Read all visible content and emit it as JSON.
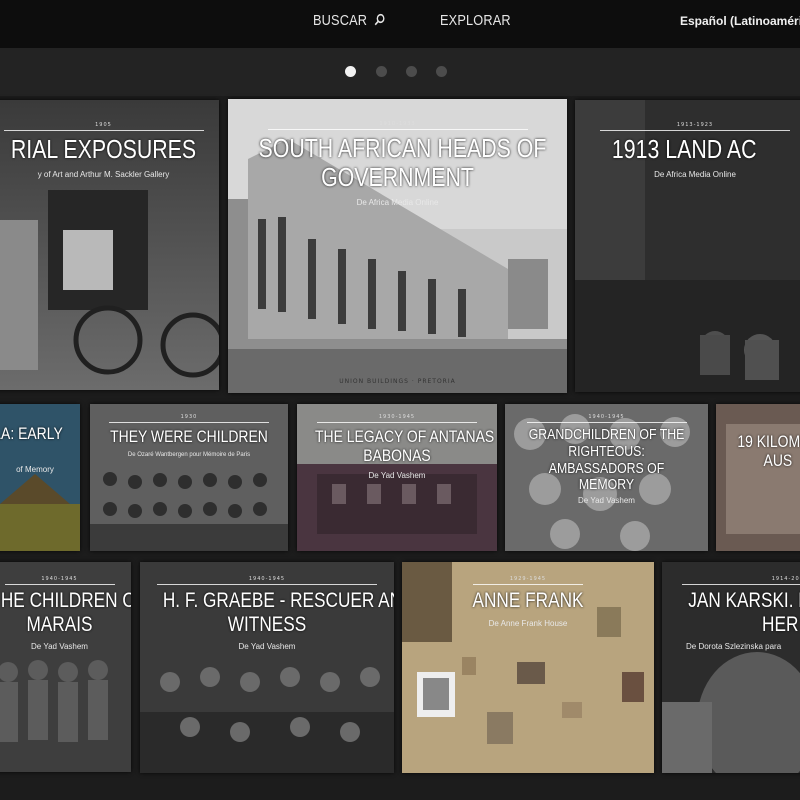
{
  "nav": {
    "search_label": "BUSCAR",
    "explore_label": "EXPLORAR",
    "language_label": "Español (Latinoamérica)"
  },
  "carousel": {
    "page_count": 4,
    "active_page": 1
  },
  "row1": [
    {
      "date": "1905",
      "title_lines": [
        "RIAL EXPOSURES",
        ""
      ],
      "source": "y of Art and Arthur M. Sackler Gallery"
    },
    {
      "date": "1910-1933",
      "title_lines": [
        "SOUTH AFRICAN HEADS OF",
        "GOVERNMENT"
      ],
      "source": "De Africa Media Online",
      "caption": "UNION BUILDINGS · PRETORIA"
    },
    {
      "date": "1913-1923",
      "title_lines": [
        "1913 LAND AC",
        ""
      ],
      "source": "De Africa Media Online"
    }
  ],
  "row2": [
    {
      "date": "",
      "title_lines": [
        "LA: EARLY",
        ""
      ],
      "source": "of Memory"
    },
    {
      "date": "1930",
      "title_lines": [
        "THEY WERE CHILDREN",
        ""
      ],
      "source": "De Ozaré Wantbergen pour Mémoire de Paris"
    },
    {
      "date": "1930-1945",
      "title_lines": [
        "THE LEGACY OF ANTANAS",
        "BABONAS"
      ],
      "source": "De Yad Vashem"
    },
    {
      "date": "1940-1945",
      "title_lines": [
        "GRANDCHILDREN OF THE",
        "RIGHTEOUS:",
        "AMBASSADORS OF",
        "MEMORY"
      ],
      "source": "De Yad Vashem"
    },
    {
      "date": "",
      "title_lines": [
        "19 KILOM",
        "AUS"
      ],
      "source": ""
    }
  ],
  "row3": [
    {
      "date": "1940-1945",
      "title_lines": [
        "HE CHILDREN OF",
        "MARAIS"
      ],
      "source": "De Yad Vashem"
    },
    {
      "date": "1940-1945",
      "title_lines": [
        "H. F. GRAEBE - RESCUER AND",
        "WITNESS"
      ],
      "source": "De Yad Vashem"
    },
    {
      "date": "1929-1945",
      "title_lines": [
        "ANNE FRANK",
        ""
      ],
      "source": "De Anne Frank House"
    },
    {
      "date": "1914-2000",
      "title_lines": [
        "JAN KARSKI. H",
        "HER"
      ],
      "source": "De Dorota Szlezinska para"
    }
  ]
}
